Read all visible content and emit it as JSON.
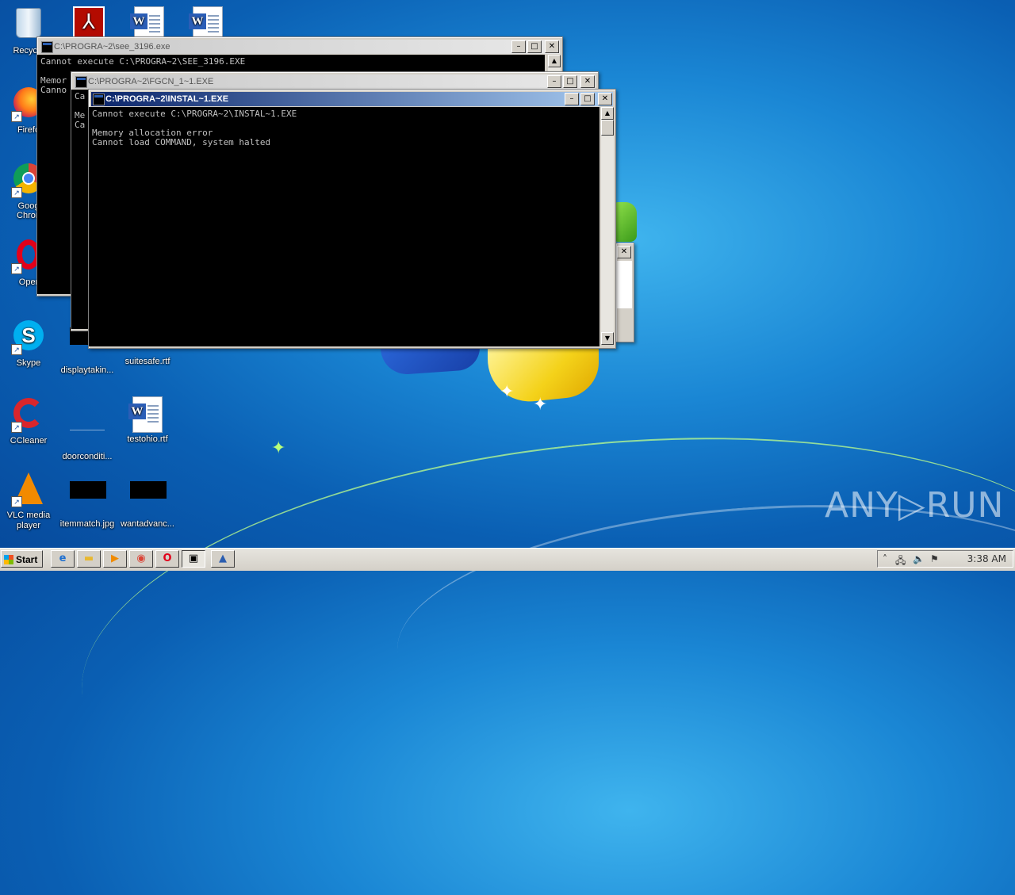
{
  "desktop": {
    "icons": [
      {
        "label": "Recycle"
      },
      {
        "label": "Firefo"
      },
      {
        "label": "Goog Chron"
      },
      {
        "label": "Oper"
      },
      {
        "label": "Skype"
      },
      {
        "label": "displaytakin..."
      },
      {
        "label": "suitesafe.rtf"
      },
      {
        "label": "CCleaner"
      },
      {
        "label": "doorconditi..."
      },
      {
        "label": "testohio.rtf"
      },
      {
        "label": "VLC media player"
      },
      {
        "label": "itemmatch.jpg"
      },
      {
        "label": "wantadvanc..."
      }
    ]
  },
  "windows": [
    {
      "title": "C:\\PROGRA~2\\see_3196.exe",
      "lines": "Cannot execute C:\\PROGRA~2\\SEE_3196.EXE\n\nMemor\nCanno"
    },
    {
      "title": "C:\\PROGRA~2\\FGCN_1~1.EXE",
      "lines": "Ca\n\nMe\nCa"
    },
    {
      "title": "C:\\PROGRA~2\\INSTAL~1.EXE",
      "lines": "Cannot execute C:\\PROGRA~2\\INSTAL~1.EXE\n\nMemory allocation error\nCannot load COMMAND, system halted"
    }
  ],
  "taskbar": {
    "start_label": "Start",
    "clock": "3:38 AM"
  },
  "watermark": "ANY▷RUN"
}
